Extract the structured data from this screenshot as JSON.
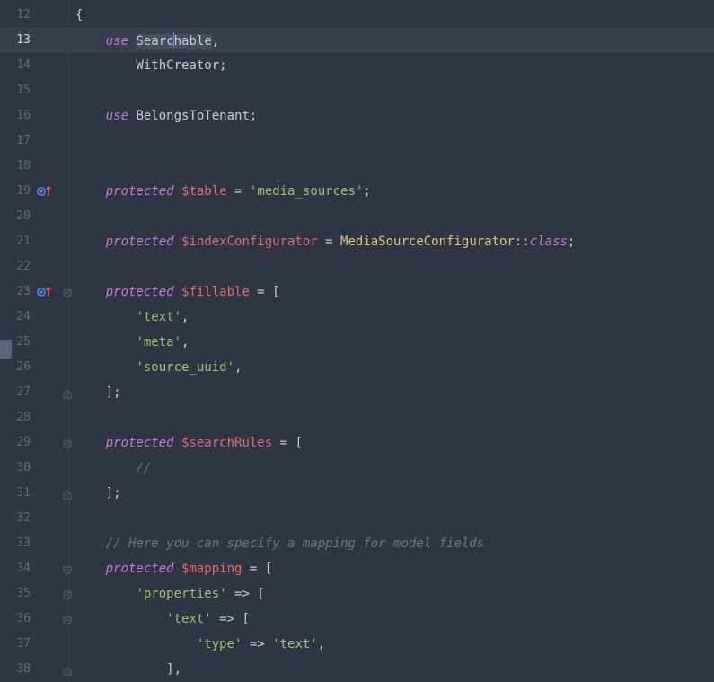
{
  "editor": {
    "language": "php",
    "current_line": 13,
    "colors": {
      "background": "#2f3542",
      "keyword": "#c678dd",
      "variable": "#e06c75",
      "string": "#98c379",
      "class": "#e5c07b",
      "comment": "#6b7385",
      "caret": "#5b8def"
    },
    "lines": [
      {
        "num": "12",
        "t": [
          {
            "s": "{",
            "c": ""
          }
        ]
      },
      {
        "num": "13",
        "current": true,
        "t": [
          {
            "s": "    ",
            "c": ""
          },
          {
            "s": "use",
            "c": "kw"
          },
          {
            "s": " ",
            "c": ""
          },
          {
            "s": "Searc",
            "c": "sel"
          },
          {
            "s": "",
            "c": "caret"
          },
          {
            "s": "hable",
            "c": "sel"
          },
          {
            "s": ",",
            "c": ""
          }
        ]
      },
      {
        "num": "14",
        "t": [
          {
            "s": "        WithCreator;",
            "c": ""
          }
        ]
      },
      {
        "num": "15",
        "t": []
      },
      {
        "num": "16",
        "t": [
          {
            "s": "    ",
            "c": ""
          },
          {
            "s": "use",
            "c": "kw"
          },
          {
            "s": " BelongsToTenant;",
            "c": ""
          }
        ]
      },
      {
        "num": "17",
        "t": []
      },
      {
        "num": "18",
        "t": []
      },
      {
        "num": "19",
        "marker": "override-up-icon",
        "t": [
          {
            "s": "    ",
            "c": ""
          },
          {
            "s": "protected",
            "c": "kw"
          },
          {
            "s": " ",
            "c": ""
          },
          {
            "s": "$table",
            "c": "var"
          },
          {
            "s": " = ",
            "c": ""
          },
          {
            "s": "'media_sources'",
            "c": "str"
          },
          {
            "s": ";",
            "c": ""
          }
        ]
      },
      {
        "num": "20",
        "t": []
      },
      {
        "num": "21",
        "t": [
          {
            "s": "    ",
            "c": ""
          },
          {
            "s": "protected",
            "c": "kw"
          },
          {
            "s": " ",
            "c": ""
          },
          {
            "s": "$indexConfigurator",
            "c": "var"
          },
          {
            "s": " = ",
            "c": ""
          },
          {
            "s": "MediaSourceConfigurator",
            "c": "cls"
          },
          {
            "s": "::",
            "c": ""
          },
          {
            "s": "class",
            "c": "kwi"
          },
          {
            "s": ";",
            "c": ""
          }
        ]
      },
      {
        "num": "22",
        "t": []
      },
      {
        "num": "23",
        "marker": "override-up-icon",
        "fold": "fold-open-icon",
        "t": [
          {
            "s": "    ",
            "c": ""
          },
          {
            "s": "protected",
            "c": "kw"
          },
          {
            "s": " ",
            "c": ""
          },
          {
            "s": "$fillable",
            "c": "var"
          },
          {
            "s": " = [",
            "c": ""
          }
        ]
      },
      {
        "num": "24",
        "t": [
          {
            "s": "        ",
            "c": ""
          },
          {
            "s": "'text'",
            "c": "str"
          },
          {
            "s": ",",
            "c": ""
          }
        ]
      },
      {
        "num": "25",
        "t": [
          {
            "s": "        ",
            "c": ""
          },
          {
            "s": "'meta'",
            "c": "str"
          },
          {
            "s": ",",
            "c": ""
          }
        ]
      },
      {
        "num": "26",
        "t": [
          {
            "s": "        ",
            "c": ""
          },
          {
            "s": "'source_uuid'",
            "c": "str"
          },
          {
            "s": ",",
            "c": ""
          }
        ]
      },
      {
        "num": "27",
        "fold": "fold-close-icon",
        "t": [
          {
            "s": "    ];",
            "c": ""
          }
        ]
      },
      {
        "num": "28",
        "t": []
      },
      {
        "num": "29",
        "fold": "fold-open-icon",
        "t": [
          {
            "s": "    ",
            "c": ""
          },
          {
            "s": "protected",
            "c": "kw"
          },
          {
            "s": " ",
            "c": ""
          },
          {
            "s": "$searchRules",
            "c": "var"
          },
          {
            "s": " = [",
            "c": ""
          }
        ]
      },
      {
        "num": "30",
        "t": [
          {
            "s": "        ",
            "c": ""
          },
          {
            "s": "//",
            "c": "cmt"
          }
        ]
      },
      {
        "num": "31",
        "fold": "fold-close-icon",
        "t": [
          {
            "s": "    ];",
            "c": ""
          }
        ]
      },
      {
        "num": "32",
        "t": []
      },
      {
        "num": "33",
        "t": [
          {
            "s": "    ",
            "c": ""
          },
          {
            "s": "// Here you can specify a mapping for model fields",
            "c": "cmt"
          }
        ]
      },
      {
        "num": "34",
        "fold": "fold-open-icon",
        "t": [
          {
            "s": "    ",
            "c": ""
          },
          {
            "s": "protected",
            "c": "kw"
          },
          {
            "s": " ",
            "c": ""
          },
          {
            "s": "$mapping",
            "c": "var"
          },
          {
            "s": " = [",
            "c": ""
          }
        ]
      },
      {
        "num": "35",
        "fold": "fold-open-icon",
        "t": [
          {
            "s": "        ",
            "c": ""
          },
          {
            "s": "'properties'",
            "c": "str"
          },
          {
            "s": " => [",
            "c": ""
          }
        ]
      },
      {
        "num": "36",
        "fold": "fold-open-icon",
        "t": [
          {
            "s": "            ",
            "c": ""
          },
          {
            "s": "'text'",
            "c": "str"
          },
          {
            "s": " => [",
            "c": ""
          }
        ]
      },
      {
        "num": "37",
        "t": [
          {
            "s": "                ",
            "c": ""
          },
          {
            "s": "'type'",
            "c": "str"
          },
          {
            "s": " => ",
            "c": ""
          },
          {
            "s": "'text'",
            "c": "str"
          },
          {
            "s": ",",
            "c": ""
          }
        ]
      },
      {
        "num": "38",
        "fold": "fold-close-icon",
        "t": [
          {
            "s": "            ],",
            "c": ""
          }
        ]
      }
    ]
  }
}
